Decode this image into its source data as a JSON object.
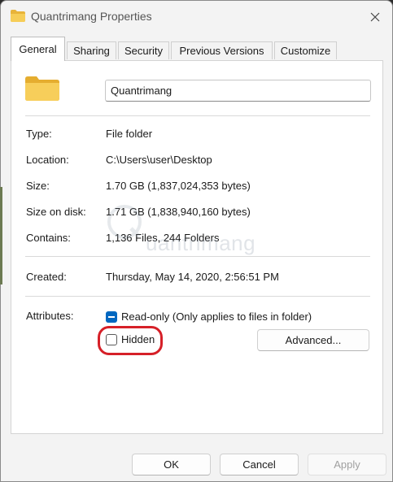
{
  "window": {
    "title": "Quantrimang Properties"
  },
  "tabs": [
    {
      "label": "General",
      "active": true
    },
    {
      "label": "Sharing"
    },
    {
      "label": "Security"
    },
    {
      "label": "Previous Versions"
    },
    {
      "label": "Customize"
    }
  ],
  "general": {
    "name_value": "Quantrimang",
    "type": {
      "label": "Type:",
      "value": "File folder"
    },
    "location": {
      "label": "Location:",
      "value": "C:\\Users\\user\\Desktop"
    },
    "size": {
      "label": "Size:",
      "value": "1.70 GB (1,837,024,353 bytes)"
    },
    "size_on_disk": {
      "label": "Size on disk:",
      "value": "1.71 GB (1,838,940,160 bytes)"
    },
    "contains": {
      "label": "Contains:",
      "value": "1,136 Files, 244 Folders"
    },
    "created": {
      "label": "Created:",
      "value": "Thursday, May 14, 2020, 2:56:51 PM"
    },
    "attributes": {
      "label": "Attributes:",
      "readonly_label": "Read-only (Only applies to files in folder)",
      "readonly_state": "indeterminate",
      "hidden_label": "Hidden",
      "hidden_checked": false,
      "advanced_label": "Advanced..."
    }
  },
  "footer": {
    "ok_label": "OK",
    "cancel_label": "Cancel",
    "apply_label": "Apply"
  },
  "watermark": {
    "text": "uantrimang"
  },
  "colors": {
    "accent": "#0067c0",
    "highlight": "#d62028",
    "folder": "#f4c542"
  }
}
